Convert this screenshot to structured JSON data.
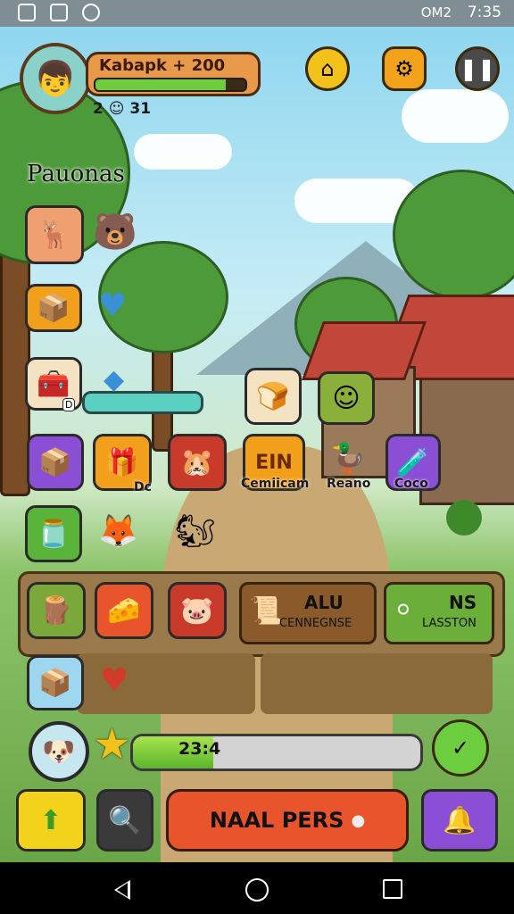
{
  "status_bar": {
    "time": "7:35",
    "network": "OM2",
    "left_icons": [
      "screenshot-icon",
      "gallery-icon",
      "notification-icon"
    ]
  },
  "player": {
    "name_xp": "Kabapk + 200",
    "xp_fraction": 0.87,
    "stats": "2 ☺ 31"
  },
  "top_buttons": [
    "house-icon",
    "gear-icon",
    "pause-icon"
  ],
  "section_title": "Pauonas",
  "shop_items": [
    {
      "label": "Cemiicam"
    },
    {
      "label": "Reano"
    },
    {
      "label": "Coco"
    }
  ],
  "mid_text": "Dc",
  "tile_left_badge": "D",
  "panel": {
    "card1": {
      "title": "ALU",
      "subtitle": "CENNEGNSE"
    },
    "card2": {
      "title": "NS",
      "subtitle": "LASSTON"
    }
  },
  "progress": {
    "value_text": "23:4",
    "fraction": 0.28
  },
  "bottom": {
    "main_button": "NAAL PERS"
  },
  "colors": {
    "accent_orange": "#e8552c",
    "accent_purple": "#8b4fd6",
    "accent_green": "#6cce3e",
    "accent_yellow": "#f2c21b"
  }
}
